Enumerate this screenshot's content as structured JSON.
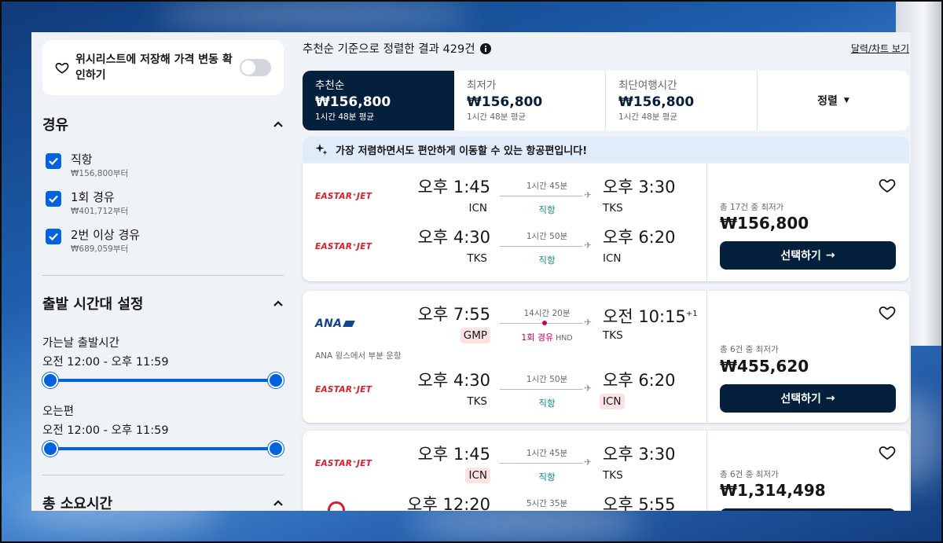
{
  "sidebar": {
    "wishlist": {
      "label": "위시리스트에 저장해 가격 변동 확인하기",
      "toggle_on": false
    },
    "stops": {
      "title": "경유",
      "options": [
        {
          "label": "직항",
          "sub": "₩156,800부터",
          "checked": true
        },
        {
          "label": "1회 경유",
          "sub": "₩401,712부터",
          "checked": true
        },
        {
          "label": "2번 이상 경유",
          "sub": "₩689,059부터",
          "checked": true
        }
      ]
    },
    "departure_time": {
      "title": "출발 시간대 설정",
      "outbound_label": "가는날 출발시간",
      "outbound_range": "오전 12:00 - 오후 11:59",
      "return_label": "오는편",
      "return_range": "오전 12:00 - 오후 11:59"
    },
    "total_duration": {
      "title": "총 소요시간"
    }
  },
  "main": {
    "result_summary": "추천순 기준으로 정렬한 결과 429건",
    "calendar_link": "달력/차트 보기",
    "sort_tabs": [
      {
        "label": "추천순",
        "price": "₩156,800",
        "avg": "1시간 48분 평균",
        "active": true
      },
      {
        "label": "최저가",
        "price": "₩156,800",
        "avg": "1시간 48분 평균",
        "active": false
      },
      {
        "label": "최단여행시간",
        "price": "₩156,800",
        "avg": "1시간 48분 평균",
        "active": false
      }
    ],
    "sort_dropdown": "정렬",
    "banner": "가장 저렴하면서도 편안하게 이동할 수 있는 항공편입니다!",
    "results": [
      {
        "legs": [
          {
            "airline": "EASTAR⁺JET",
            "dep_time": "오후 1:45",
            "dep_code": "ICN",
            "duration": "1시간 45분",
            "stops": "직항",
            "arr_time": "오후 3:30",
            "arr_code": "TKS"
          },
          {
            "airline": "EASTAR⁺JET",
            "dep_time": "오후 4:30",
            "dep_code": "TKS",
            "duration": "1시간 50분",
            "stops": "직항",
            "arr_time": "오후 6:20",
            "arr_code": "ICN"
          }
        ],
        "price_note": "총 17건 중 최저가",
        "price": "₩156,800",
        "select_label": "선택하기"
      },
      {
        "legs": [
          {
            "airline": "ANA",
            "dep_time": "오후 7:55",
            "dep_code": "GMP",
            "duration": "14시간 20분",
            "stops": "1회 경유",
            "via": "HND",
            "arr_time": "오전 10:15",
            "arr_plus": "+1",
            "arr_code": "TKS"
          },
          {
            "airline": "EASTAR⁺JET",
            "dep_time": "오후 4:30",
            "dep_code": "TKS",
            "duration": "1시간 50분",
            "stops": "직항",
            "arr_time": "오후 6:20",
            "arr_code": "ICN"
          }
        ],
        "partner_note": "ANA 윙스에서 부분 운항",
        "price_note": "총 6건 중 최저가",
        "price": "₩455,620",
        "select_label": "선택하기"
      },
      {
        "legs": [
          {
            "airline": "EASTAR⁺JET",
            "dep_time": "오후 1:45",
            "dep_code": "ICN",
            "duration": "1시간 45분",
            "stops": "직항",
            "arr_time": "오후 3:30",
            "arr_code": "TKS"
          },
          {
            "airline": "JAL",
            "dep_time": "오후 12:20",
            "duration": "5시간 35분",
            "arr_time": "오후 5:55"
          }
        ],
        "price_note": "총 6건 중 최저가",
        "price": "₩1,314,498"
      }
    ]
  },
  "colors": {
    "navy": "#05203c",
    "accent_blue": "#0062e3",
    "direct_green": "#0a8a7a",
    "stop_pink": "#c8005d",
    "brand_red": "#d81e2c"
  }
}
